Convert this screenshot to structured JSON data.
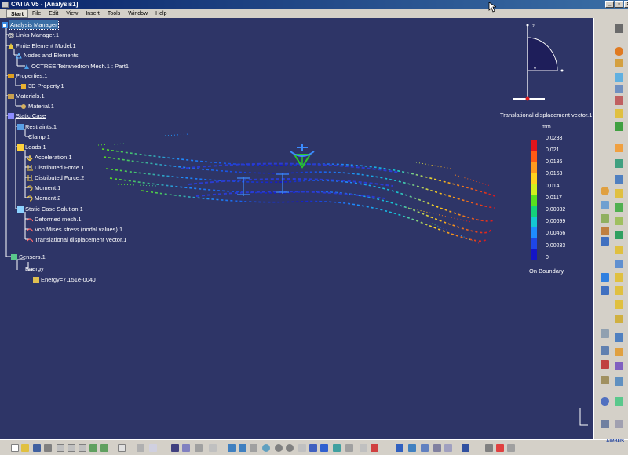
{
  "window": {
    "title": "CATIA V5 - [Analysis1]",
    "minimize_glyph": "_",
    "restore_glyph": "▫",
    "close_glyph": "×"
  },
  "menu": {
    "items": [
      "Start",
      "File",
      "Edit",
      "View",
      "Insert",
      "Tools",
      "Window",
      "Help"
    ]
  },
  "tree": {
    "root": "Analysis Manager",
    "links_manager": "Links Manager.1",
    "fem": "Finite Element Model.1",
    "nodes_elements": "Nodes and Elements",
    "mesh": "OCTREE Tetrahedron Mesh.1 : Part1",
    "properties": "Properties.1",
    "property_3d": "3D Property.1",
    "materials": "Materials.1",
    "material": "Material.1",
    "static_case": "Static Case",
    "restraints": "Restraints.1",
    "clamp": "Clamp.1",
    "loads": "Loads.1",
    "acceleration": "Acceleration.1",
    "dist_force_1": "Distributed Force.1",
    "dist_force_2": "Distributed Force.2",
    "moment_1": "Moment.1",
    "moment_2": "Moment.2",
    "solution": "Static Case Solution.1",
    "deformed_mesh": "Deformed mesh.1",
    "von_mises": "Von Mises stress (nodal values).1",
    "translational": "Translational displacement vector.1",
    "sensors": "Sensors.1",
    "energy": "Energy",
    "energy_value": "Energy=7,151e-004J"
  },
  "compass": {
    "z_label": "z",
    "y_label": "y"
  },
  "legend": {
    "title": "Translational displacement vector.1",
    "unit": "mm",
    "values": [
      "0,0233",
      "0,021",
      "0,0186",
      "0,0163",
      "0,014",
      "0,0117",
      "0,00932",
      "0,00699",
      "0,00466",
      "0,00233",
      "0"
    ],
    "colors": [
      "#e0141b",
      "#ff5a14",
      "#ff9a1e",
      "#ffd21e",
      "#d2ef1e",
      "#5ae01e",
      "#14d27a",
      "#14c8d2",
      "#1e8cff",
      "#1e46e6",
      "#1414c8"
    ],
    "footer": "On Boundary"
  },
  "status": {
    "brand": "AIRBUS"
  },
  "colors": {
    "background": "#2e3567",
    "toolbar": "#d4d0c8",
    "title_bar": "#0a246a"
  }
}
